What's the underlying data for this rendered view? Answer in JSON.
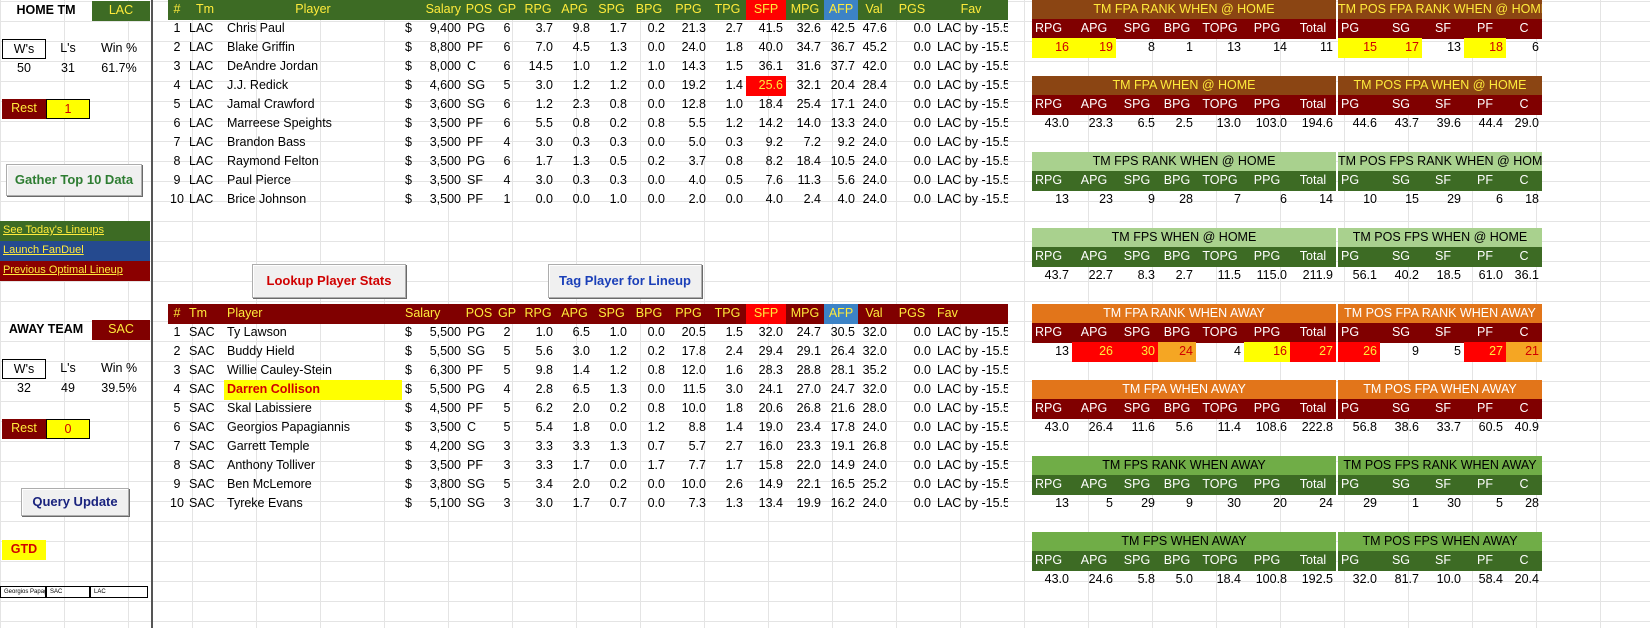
{
  "home": {
    "label": "HOME TM",
    "team": "LAC",
    "record_headers": [
      "W's",
      "L's",
      "Win %"
    ],
    "record_values": [
      "50",
      "31",
      "61.7%"
    ],
    "rest_label": "Rest",
    "rest_value": "1"
  },
  "away": {
    "label": "AWAY TEAM",
    "team": "SAC",
    "record_headers": [
      "W's",
      "L's",
      "Win %"
    ],
    "record_values": [
      "32",
      "49",
      "39.5%"
    ],
    "rest_label": "Rest",
    "rest_value": "0"
  },
  "buttons": {
    "gather": "Gather Top 10 Data",
    "lookup": "Lookup Player Stats",
    "tag": "Tag Player for Lineup",
    "query": "Query Update"
  },
  "links": {
    "lineups": "See Today's Lineups",
    "fanduel": "Launch FanDuel",
    "optimal": "Previous Optimal Lineup"
  },
  "gtd": "GTD",
  "footer_cells": [
    "Georgios Papagi",
    "SAC",
    "LAC"
  ],
  "player_columns": [
    "#",
    "Tm",
    "Player",
    "Salary",
    "POS",
    "GP",
    "RPG",
    "APG",
    "SPG",
    "BPG",
    "PPG",
    "TPG",
    "SFP",
    "MPG",
    "AFP",
    "Val",
    "PGS",
    "Fav"
  ],
  "home_players": [
    [
      "1",
      "LAC",
      "Chris Paul",
      "$",
      "9,400",
      "PG",
      "6",
      "3.7",
      "9.8",
      "1.7",
      "0.2",
      "21.3",
      "2.7",
      "41.5",
      "32.6",
      "42.5",
      "47.6",
      "0.0",
      "LAC by -15.5"
    ],
    [
      "2",
      "LAC",
      "Blake Griffin",
      "$",
      "8,800",
      "PF",
      "6",
      "7.0",
      "4.5",
      "1.3",
      "0.0",
      "24.0",
      "1.8",
      "40.0",
      "34.7",
      "36.7",
      "45.2",
      "0.0",
      "LAC by -15.5"
    ],
    [
      "3",
      "LAC",
      "DeAndre Jordan",
      "$",
      "8,000",
      "C",
      "6",
      "14.5",
      "1.0",
      "1.2",
      "1.0",
      "14.3",
      "1.5",
      "36.1",
      "31.6",
      "37.7",
      "42.0",
      "0.0",
      "LAC by -15.5"
    ],
    [
      "4",
      "LAC",
      "J.J. Redick",
      "$",
      "4,600",
      "SG",
      "5",
      "3.0",
      "1.2",
      "1.2",
      "0.0",
      "19.2",
      "1.4",
      "25.6",
      "32.1",
      "20.4",
      "28.4",
      "0.0",
      "LAC by -15.5"
    ],
    [
      "5",
      "LAC",
      "Jamal Crawford",
      "$",
      "3,600",
      "SG",
      "6",
      "1.2",
      "2.3",
      "0.8",
      "0.0",
      "12.8",
      "1.0",
      "18.4",
      "25.4",
      "17.1",
      "24.0",
      "0.0",
      "LAC by -15.5"
    ],
    [
      "6",
      "LAC",
      "Marreese Speights",
      "$",
      "3,500",
      "PF",
      "6",
      "5.5",
      "0.8",
      "0.2",
      "0.8",
      "5.5",
      "1.2",
      "14.2",
      "14.0",
      "13.3",
      "24.0",
      "0.0",
      "LAC by -15.5"
    ],
    [
      "7",
      "LAC",
      "Brandon Bass",
      "$",
      "3,500",
      "PF",
      "4",
      "3.0",
      "0.3",
      "0.3",
      "0.0",
      "5.0",
      "0.3",
      "9.2",
      "7.2",
      "9.2",
      "24.0",
      "0.0",
      "LAC by -15.5"
    ],
    [
      "8",
      "LAC",
      "Raymond Felton",
      "$",
      "3,500",
      "PG",
      "6",
      "1.7",
      "1.3",
      "0.5",
      "0.2",
      "3.7",
      "0.8",
      "8.2",
      "18.4",
      "10.5",
      "24.0",
      "0.0",
      "LAC by -15.5"
    ],
    [
      "9",
      "LAC",
      "Paul Pierce",
      "$",
      "3,500",
      "SF",
      "4",
      "3.0",
      "0.3",
      "0.3",
      "0.0",
      "4.0",
      "0.5",
      "7.6",
      "11.3",
      "5.6",
      "24.0",
      "0.0",
      "LAC by -15.5"
    ],
    [
      "10",
      "LAC",
      "Brice Johnson",
      "$",
      "3,500",
      "PF",
      "1",
      "0.0",
      "0.0",
      "1.0",
      "0.0",
      "2.0",
      "0.0",
      "4.0",
      "2.4",
      "4.0",
      "24.0",
      "0.0",
      "LAC by -15.5"
    ]
  ],
  "away_players": [
    [
      "1",
      "SAC",
      "Ty Lawson",
      "$",
      "5,500",
      "PG",
      "2",
      "1.0",
      "6.5",
      "1.0",
      "0.0",
      "20.5",
      "1.5",
      "32.0",
      "24.7",
      "30.5",
      "32.0",
      "0.0",
      "LAC by -15.5"
    ],
    [
      "2",
      "SAC",
      "Buddy Hield",
      "$",
      "5,500",
      "SG",
      "5",
      "5.6",
      "3.0",
      "1.2",
      "0.2",
      "17.8",
      "2.4",
      "29.4",
      "29.1",
      "26.4",
      "32.0",
      "0.0",
      "LAC by -15.5"
    ],
    [
      "3",
      "SAC",
      "Willie Cauley-Stein",
      "$",
      "6,300",
      "PF",
      "5",
      "9.8",
      "1.4",
      "1.2",
      "0.8",
      "12.0",
      "1.6",
      "28.3",
      "28.8",
      "28.1",
      "35.2",
      "0.0",
      "LAC by -15.5"
    ],
    [
      "4",
      "SAC",
      "Darren Collison",
      "$",
      "5,500",
      "PG",
      "4",
      "2.8",
      "6.5",
      "1.3",
      "0.0",
      "11.5",
      "3.0",
      "24.1",
      "27.0",
      "24.7",
      "32.0",
      "0.0",
      "LAC by -15.5"
    ],
    [
      "5",
      "SAC",
      "Skal Labissiere",
      "$",
      "4,500",
      "PF",
      "5",
      "6.2",
      "2.0",
      "0.2",
      "0.8",
      "10.0",
      "1.8",
      "20.6",
      "26.8",
      "21.6",
      "28.0",
      "0.0",
      "LAC by -15.5"
    ],
    [
      "6",
      "SAC",
      "Georgios Papagiannis",
      "$",
      "3,500",
      "C",
      "5",
      "5.4",
      "1.8",
      "0.0",
      "1.2",
      "8.8",
      "1.4",
      "19.0",
      "23.4",
      "17.8",
      "24.0",
      "0.0",
      "LAC by -15.5"
    ],
    [
      "7",
      "SAC",
      "Garrett Temple",
      "$",
      "4,200",
      "SG",
      "3",
      "3.3",
      "3.3",
      "1.3",
      "0.7",
      "5.7",
      "2.7",
      "16.0",
      "23.3",
      "19.1",
      "26.8",
      "0.0",
      "LAC by -15.5"
    ],
    [
      "8",
      "SAC",
      "Anthony Tolliver",
      "$",
      "3,500",
      "PF",
      "3",
      "3.3",
      "1.7",
      "0.0",
      "1.7",
      "7.7",
      "1.7",
      "15.8",
      "22.0",
      "14.9",
      "24.0",
      "0.0",
      "LAC by -15.5"
    ],
    [
      "9",
      "SAC",
      "Ben McLemore",
      "$",
      "3,800",
      "SG",
      "5",
      "3.4",
      "2.0",
      "0.2",
      "0.0",
      "10.0",
      "2.6",
      "14.9",
      "22.1",
      "16.5",
      "25.2",
      "0.0",
      "LAC by -15.5"
    ],
    [
      "10",
      "SAC",
      "Tyreke Evans",
      "$",
      "5,100",
      "SG",
      "3",
      "3.0",
      "1.7",
      "0.7",
      "0.0",
      "7.3",
      "1.3",
      "13.4",
      "19.9",
      "16.2",
      "24.0",
      "0.0",
      "LAC by -15.5"
    ]
  ],
  "team_blocks": [
    {
      "title": "TM FPA RANK WHEN @ HOME",
      "cols": [
        "RPG",
        "APG",
        "SPG",
        "BPG",
        "TOPG",
        "PPG",
        "Total"
      ],
      "values": [
        "16",
        "19",
        "8",
        "1",
        "13",
        "14",
        "11"
      ],
      "hl": [
        "y",
        "y",
        "",
        "",
        "",
        "",
        ""
      ]
    },
    {
      "title": "TM FPA WHEN @ HOME",
      "cols": [
        "RPG",
        "APG",
        "SPG",
        "BPG",
        "TOPG",
        "PPG",
        "Total"
      ],
      "values": [
        "43.0",
        "23.3",
        "6.5",
        "2.5",
        "13.0",
        "103.0",
        "194.6"
      ],
      "hl": [
        "",
        "",
        "",
        "",
        "",
        "",
        ""
      ]
    },
    {
      "title": "TM FPS RANK WHEN @ HOME",
      "cols": [
        "RPG",
        "APG",
        "SPG",
        "BPG",
        "TOPG",
        "PPG",
        "Total"
      ],
      "values": [
        "13",
        "23",
        "9",
        "28",
        "7",
        "6",
        "14"
      ],
      "hl": [
        "",
        "",
        "",
        "",
        "",
        "",
        ""
      ]
    },
    {
      "title": "TM FPS WHEN @ HOME",
      "cols": [
        "RPG",
        "APG",
        "SPG",
        "BPG",
        "TOPG",
        "PPG",
        "Total"
      ],
      "values": [
        "43.7",
        "22.7",
        "8.3",
        "2.7",
        "11.5",
        "115.0",
        "211.9"
      ],
      "hl": [
        "",
        "",
        "",
        "",
        "",
        "",
        ""
      ]
    },
    {
      "title": "TM FPA RANK WHEN AWAY",
      "cols": [
        "RPG",
        "APG",
        "SPG",
        "BPG",
        "TOPG",
        "PPG",
        "Total"
      ],
      "values": [
        "13",
        "26",
        "30",
        "24",
        "4",
        "16",
        "27"
      ],
      "hl": [
        "",
        "r",
        "r",
        "o",
        "",
        "y",
        "r"
      ]
    },
    {
      "title": "TM FPA WHEN AWAY",
      "cols": [
        "RPG",
        "APG",
        "SPG",
        "BPG",
        "TOPG",
        "PPG",
        "Total"
      ],
      "values": [
        "43.0",
        "26.4",
        "11.6",
        "5.6",
        "11.4",
        "108.6",
        "222.8"
      ],
      "hl": [
        "",
        "",
        "",
        "",
        "",
        "",
        ""
      ]
    },
    {
      "title": "TM FPS RANK WHEN AWAY",
      "cols": [
        "RPG",
        "APG",
        "SPG",
        "BPG",
        "TOPG",
        "PPG",
        "Total"
      ],
      "values": [
        "13",
        "5",
        "29",
        "9",
        "30",
        "20",
        "24"
      ],
      "hl": [
        "",
        "",
        "",
        "",
        "",
        "",
        ""
      ]
    },
    {
      "title": "TM FPS WHEN AWAY",
      "cols": [
        "RPG",
        "APG",
        "SPG",
        "BPG",
        "TOPG",
        "PPG",
        "Total"
      ],
      "values": [
        "43.0",
        "24.6",
        "5.8",
        "5.0",
        "18.4",
        "100.8",
        "192.5"
      ],
      "hl": [
        "",
        "",
        "",
        "",
        "",
        "",
        ""
      ]
    }
  ],
  "pos_blocks": [
    {
      "title": "TM POS FPA RANK WHEN @ HOME",
      "cols": [
        "PG",
        "SG",
        "SF",
        "PF",
        "C"
      ],
      "values": [
        "15",
        "17",
        "13",
        "18",
        "6"
      ],
      "hl": [
        "y",
        "y",
        "",
        "y",
        ""
      ]
    },
    {
      "title": "TM POS FPA WHEN @ HOME",
      "cols": [
        "PG",
        "SG",
        "SF",
        "PF",
        "C"
      ],
      "values": [
        "44.6",
        "43.7",
        "39.6",
        "44.4",
        "29.0"
      ],
      "hl": [
        "",
        "",
        "",
        "",
        ""
      ]
    },
    {
      "title": "TM POS FPS RANK WHEN @ HOME",
      "cols": [
        "PG",
        "SG",
        "SF",
        "PF",
        "C"
      ],
      "values": [
        "10",
        "15",
        "29",
        "6",
        "18"
      ],
      "hl": [
        "",
        "",
        "",
        "",
        ""
      ]
    },
    {
      "title": "TM POS FPS WHEN @ HOME",
      "cols": [
        "PG",
        "SG",
        "SF",
        "PF",
        "C"
      ],
      "values": [
        "56.1",
        "40.2",
        "18.5",
        "61.0",
        "36.1"
      ],
      "hl": [
        "",
        "",
        "",
        "",
        ""
      ]
    },
    {
      "title": "TM POS FPA RANK WHEN AWAY",
      "cols": [
        "PG",
        "SG",
        "SF",
        "PF",
        "C"
      ],
      "values": [
        "26",
        "9",
        "5",
        "27",
        "21"
      ],
      "hl": [
        "r",
        "",
        "",
        "r",
        "o"
      ]
    },
    {
      "title": "TM POS FPA WHEN AWAY",
      "cols": [
        "PG",
        "SG",
        "SF",
        "PF",
        "C"
      ],
      "values": [
        "56.8",
        "38.6",
        "33.7",
        "60.5",
        "40.9"
      ],
      "hl": [
        "",
        "",
        "",
        "",
        ""
      ]
    },
    {
      "title": "TM POS FPS RANK WHEN AWAY",
      "cols": [
        "PG",
        "SG",
        "SF",
        "PF",
        "C"
      ],
      "values": [
        "29",
        "1",
        "30",
        "5",
        "28"
      ],
      "hl": [
        "",
        "",
        "",
        "",
        ""
      ]
    },
    {
      "title": "TM POS FPS WHEN AWAY",
      "cols": [
        "PG",
        "SG",
        "SF",
        "PF",
        "C"
      ],
      "values": [
        "32.0",
        "81.7",
        "10.0",
        "58.4",
        "20.4"
      ],
      "hl": [
        "",
        "",
        "",
        "",
        ""
      ]
    }
  ]
}
